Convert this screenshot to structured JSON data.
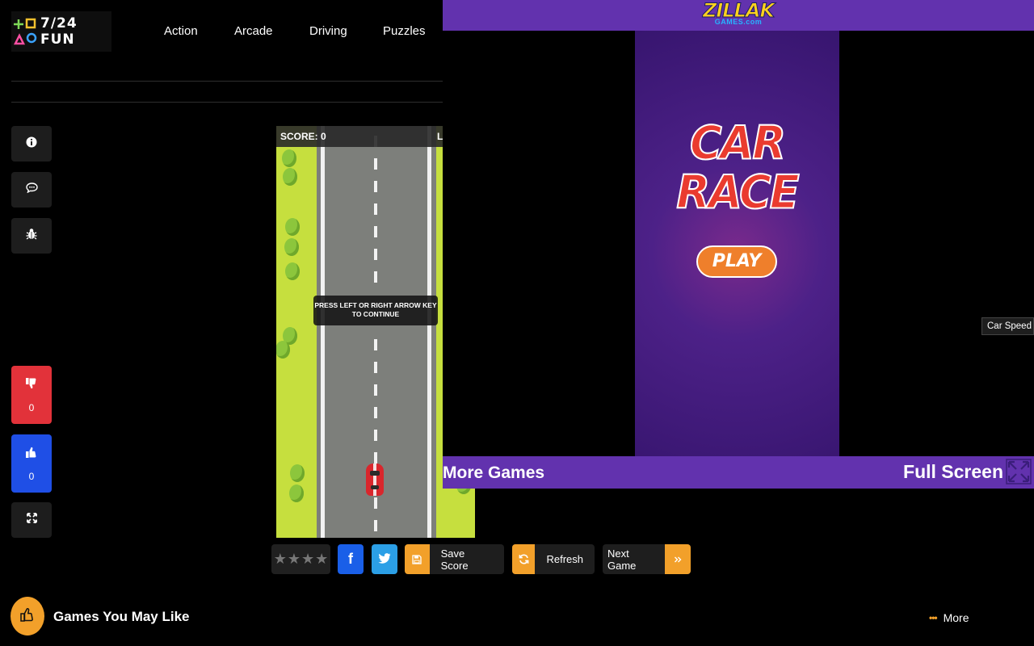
{
  "header": {
    "logo_text": "7/24 FUN",
    "nav": [
      {
        "label": "Action"
      },
      {
        "label": "Arcade"
      },
      {
        "label": "Driving"
      },
      {
        "label": "Puzzles"
      }
    ]
  },
  "sidebar": {
    "info_icon": "info-icon",
    "comment_icon": "comment-icon",
    "bug_icon": "bug-icon",
    "dislike_count": "0",
    "like_count": "0",
    "fullscreen_icon": "expand-icon"
  },
  "game": {
    "score_label": "SCORE: 0",
    "edge_char": "L",
    "instruction": "PRESS LEFT OR RIGHT ARROW KEY TO CONTINUE"
  },
  "overlay": {
    "brand_main": "ZILLAK",
    "brand_sub": "GAMES.com",
    "promo_title": "CAR RACE",
    "play_label": "PLAY",
    "more_games_label": "More Games",
    "full_screen_label": "Full Screen"
  },
  "tooltip": {
    "text": "Car Speed B"
  },
  "actions": {
    "rating_stars": 4,
    "rating_value": 0,
    "facebook_label": "f",
    "twitter_icon": "twitter-icon",
    "save_score_label": "Save Score",
    "refresh_label": "Refresh",
    "next_game_label": "Next Game"
  },
  "footer": {
    "section_title": "Games You May Like",
    "more_label": "More"
  },
  "colors": {
    "accent_orange": "#f2a02a",
    "purple_bar": "#6232ae",
    "dislike_red": "#e2323a",
    "like_blue": "#1f4fe6",
    "facebook_blue": "#1a5fe8",
    "twitter_blue": "#2b9fe6"
  }
}
